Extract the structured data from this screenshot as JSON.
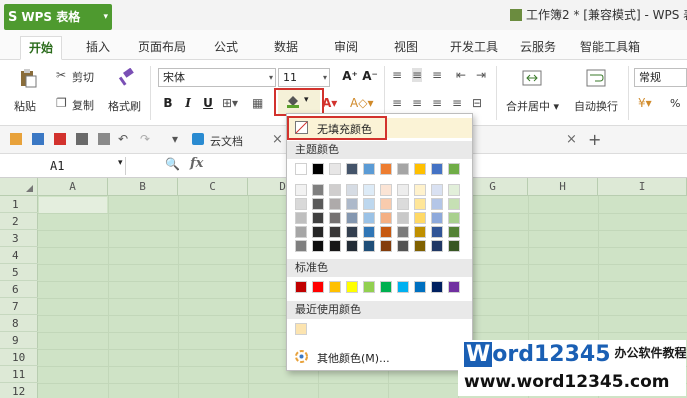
{
  "app": {
    "name": "WPS 表格",
    "doc_title": "工作簿2 * [兼容模式] - WPS 表"
  },
  "tabs": [
    "开始",
    "插入",
    "页面布局",
    "公式",
    "数据",
    "审阅",
    "视图",
    "开发工具",
    "云服务",
    "智能工具箱"
  ],
  "ribbon": {
    "paste": "粘贴",
    "cut": "剪切",
    "copy": "复制",
    "format_painter": "格式刷",
    "font_name": "宋体",
    "font_size": "11",
    "bold": "B",
    "italic": "I",
    "underline": "U",
    "grow": "A⁺",
    "shrink": "A⁻",
    "merge_center": "合并居中",
    "wrap_text": "自动换行",
    "number_format": "常规",
    "percent": "%"
  },
  "quick_bar": {
    "cloud_doc": "云文档",
    "plus": "+",
    "close": "×"
  },
  "formula_bar": {
    "cell_ref": "A1",
    "fx": "fx"
  },
  "grid": {
    "columns": [
      "A",
      "B",
      "C",
      "D",
      "E",
      "F",
      "G",
      "H",
      "I"
    ],
    "rows": [
      "1",
      "2",
      "3",
      "4",
      "5",
      "6",
      "7",
      "8",
      "9",
      "10",
      "11",
      "12"
    ]
  },
  "fill_menu": {
    "no_fill": "无填充颜色",
    "theme_header": "主题颜色",
    "standard_header": "标准色",
    "recent_header": "最近使用颜色",
    "more_colors": "其他颜色(M)...",
    "theme_top": [
      "#ffffff",
      "#000000",
      "#e7e6e6",
      "#44546a",
      "#5b9bd5",
      "#ed7d31",
      "#a5a5a5",
      "#ffc000",
      "#4472c4",
      "#70ad47"
    ],
    "theme_shades": [
      [
        "#f2f2f2",
        "#7f7f7f",
        "#d0cece",
        "#d6dce4",
        "#ddebf7",
        "#fbe4d5",
        "#ededed",
        "#fff2cc",
        "#d9e1f2",
        "#e2efda"
      ],
      [
        "#d9d9d9",
        "#595959",
        "#aeaaaa",
        "#adb9ca",
        "#bdd7ee",
        "#f8cbad",
        "#dbdbdb",
        "#ffe699",
        "#b4c6e7",
        "#c6e0b4"
      ],
      [
        "#bfbfbf",
        "#404040",
        "#757171",
        "#8497b0",
        "#9bc2e6",
        "#f4b084",
        "#c9c9c9",
        "#ffd966",
        "#8ea9db",
        "#a9d08e"
      ],
      [
        "#a6a6a6",
        "#262626",
        "#3a3838",
        "#333f4f",
        "#2f75b5",
        "#c65911",
        "#7b7b7b",
        "#bf8f00",
        "#305496",
        "#548235"
      ],
      [
        "#7f7f7f",
        "#0d0d0d",
        "#171616",
        "#222b35",
        "#1f4e78",
        "#833c0b",
        "#525252",
        "#7f6000",
        "#203764",
        "#375623"
      ]
    ],
    "standard": [
      "#c00000",
      "#ff0000",
      "#ffc000",
      "#ffff00",
      "#92d050",
      "#00b050",
      "#00b0f0",
      "#0070c0",
      "#002060",
      "#7030a0"
    ],
    "recent": [
      "#fce4b0"
    ]
  },
  "watermark": {
    "brand_w": "W",
    "brand_rest": "ord12345",
    "cn": "办公软件教程",
    "url": "www.word12345.com"
  }
}
